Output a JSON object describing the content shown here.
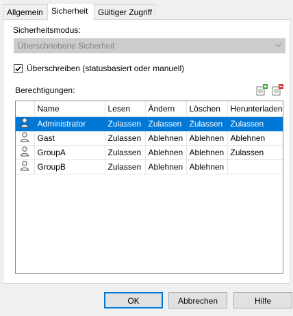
{
  "tabs": [
    {
      "label": "Allgemein"
    },
    {
      "label": "Sicherheit",
      "active": true
    },
    {
      "label": "Gültiger Zugriff"
    }
  ],
  "security_mode": {
    "label": "Sicherheitsmodus:",
    "value": "Überschriebene Sicherheit"
  },
  "override": {
    "label": "Überschreiben (statusbasiert oder manuell)",
    "checked": true
  },
  "permissions": {
    "label": "Berechtigungen:",
    "add_icon": "add-permission-icon",
    "remove_icon": "remove-permission-icon",
    "columns": [
      "",
      "Name",
      "Lesen",
      "Ändern",
      "Löschen",
      "Herunterladen"
    ],
    "rows": [
      {
        "name": "Administrator",
        "lesen": "Zulassen",
        "aendern": "Zulassen",
        "loeschen": "Zulassen",
        "herunterladen": "Zulassen",
        "selected": true
      },
      {
        "name": "Gast",
        "lesen": "Zulassen",
        "aendern": "Ablehnen",
        "loeschen": "Ablehnen",
        "herunterladen": "Ablehnen"
      },
      {
        "name": "GroupA",
        "lesen": "Zulassen",
        "aendern": "Ablehnen",
        "loeschen": "Ablehnen",
        "herunterladen": "Zulassen"
      },
      {
        "name": "GroupB",
        "lesen": "Zulassen",
        "aendern": "Ablehnen",
        "loeschen": "Ablehnen",
        "herunterladen": ""
      }
    ]
  },
  "buttons": {
    "ok": "OK",
    "cancel": "Abbrechen",
    "help": "Hilfe"
  },
  "colors": {
    "selection": "#0078d7",
    "disabled_combo": "#cccccc"
  }
}
